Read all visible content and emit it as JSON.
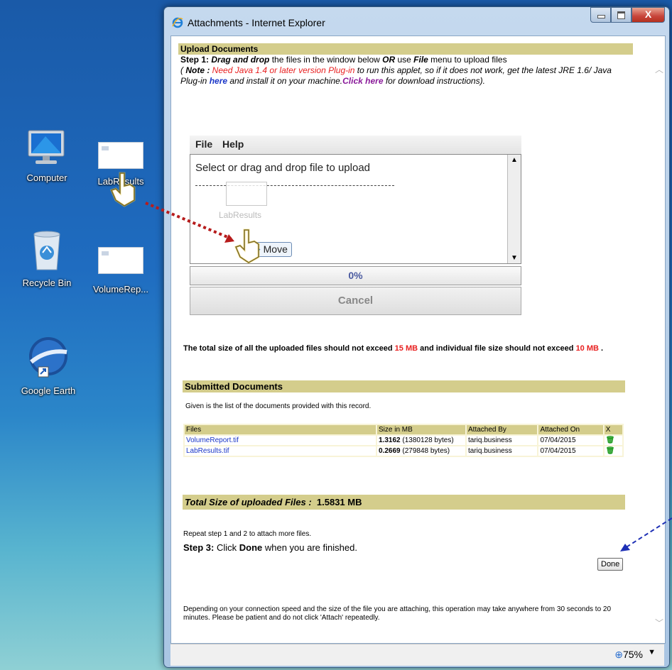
{
  "desktop": {
    "icons": [
      {
        "label": "Computer"
      },
      {
        "label": "LabResults"
      },
      {
        "label": "Recycle Bin"
      },
      {
        "label": "VolumeRep..."
      },
      {
        "label": "Google Earth"
      }
    ]
  },
  "window": {
    "title": "Attachments - Internet Explorer",
    "close_glyph": "X"
  },
  "upload": {
    "heading": "Upload Documents",
    "step1_label": "Step 1:",
    "step1_dragdrop": "Drag and drop",
    "step1_mid": " the files in the window below ",
    "step1_or": "OR",
    "step1_use": " use ",
    "step1_file": "File",
    "step1_end": " menu to upload files",
    "note_open": "( ",
    "note_label": "Note :",
    "note_red": " Need Java 1.4 or later version Plug-in",
    "note_mid": " to run this applet, so if it does not work, get the latest JRE 1.6/ Java Plug-in ",
    "here": "here",
    "note_mid2": " and install it on your machine.",
    "click_here": "Click here",
    "note_end": " for download instructions)."
  },
  "applet": {
    "menu": [
      "File",
      "Help"
    ],
    "drop_text": "Select or drag and drop file to upload",
    "ghost_label": "LabResults",
    "progress": "0%",
    "cancel": "Cancel",
    "move_label": "Move"
  },
  "limits": {
    "pre": "The total size of all the uploaded files should not exceed ",
    "total": "15 MB",
    "mid": " and individual file size should not exceed ",
    "each": "10 MB",
    "post": " ."
  },
  "submitted": {
    "heading": "Submitted Documents",
    "given": "Given is the list of the documents provided with this record.",
    "columns": [
      "Files",
      "Size in MB",
      "Attached By",
      "Attached On",
      "X"
    ],
    "rows": [
      {
        "file": "VolumeReport.tif",
        "size_bold": "1.3162",
        "size_rest": " (1380128 bytes)",
        "by": "tariq.business",
        "on": "07/04/2015"
      },
      {
        "file": "LabResults.tif",
        "size_bold": "0.2669",
        "size_rest": " (279848 bytes)",
        "by": "tariq.business",
        "on": "07/04/2015"
      }
    ]
  },
  "total": {
    "label": "Total Size of uploaded Files :",
    "value": "1.5831 MB"
  },
  "repeat": "Repeat step 1 and 2 to attach more files.",
  "step3": {
    "label": "Step 3:",
    "pre": " Click ",
    "done_word": "Done",
    "post": " when you are finished."
  },
  "done_button": "Done",
  "footer": "Depending on your connection speed and the size of the file you are attaching, this operation may take anywhere from 30 seconds to 20 minutes. Please be patient and do not click 'Attach' repeatedly.",
  "statusbar": {
    "zoom": "75%"
  },
  "colors": {
    "section_bar": "#d4cd8c",
    "red": "#e82020",
    "link": "#1a36c8",
    "link_purple": "#8a1b9a"
  }
}
